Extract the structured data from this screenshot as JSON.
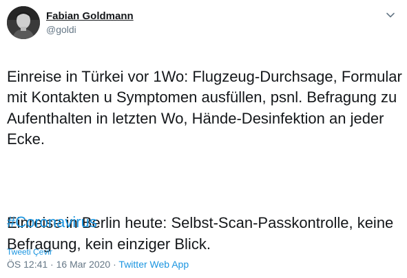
{
  "author": {
    "display_name": "Fabian Goldmann",
    "handle": "@goldi"
  },
  "tweet": {
    "paragraph_1": "Einreise in Türkei vor 1Wo: Flugzeug-Durchsage, Formular mit Kontakten u Symptomen ausfüllen, psnl. Befragung zu Aufenthalten in letzten Wo, Hände-Desinfektion an jeder Ecke.",
    "paragraph_2": "Einreise in Berlin heute: Selbst-Scan-Passkontrolle, keine Befragung, kein einziger Blick.",
    "hashtag": "#Coronavirus"
  },
  "translate_link": "Tweeti Çevir",
  "meta": {
    "time": "ÖS 12:41",
    "separator": " · ",
    "date": "16 Mar 2020",
    "separator_2": " · ",
    "app": "Twitter Web App"
  },
  "icons": {
    "avatar": "profile-photo",
    "caret": "chevron-down-icon"
  },
  "colors": {
    "link": "#1b95e0",
    "text": "#14171a",
    "secondary": "#657786"
  }
}
